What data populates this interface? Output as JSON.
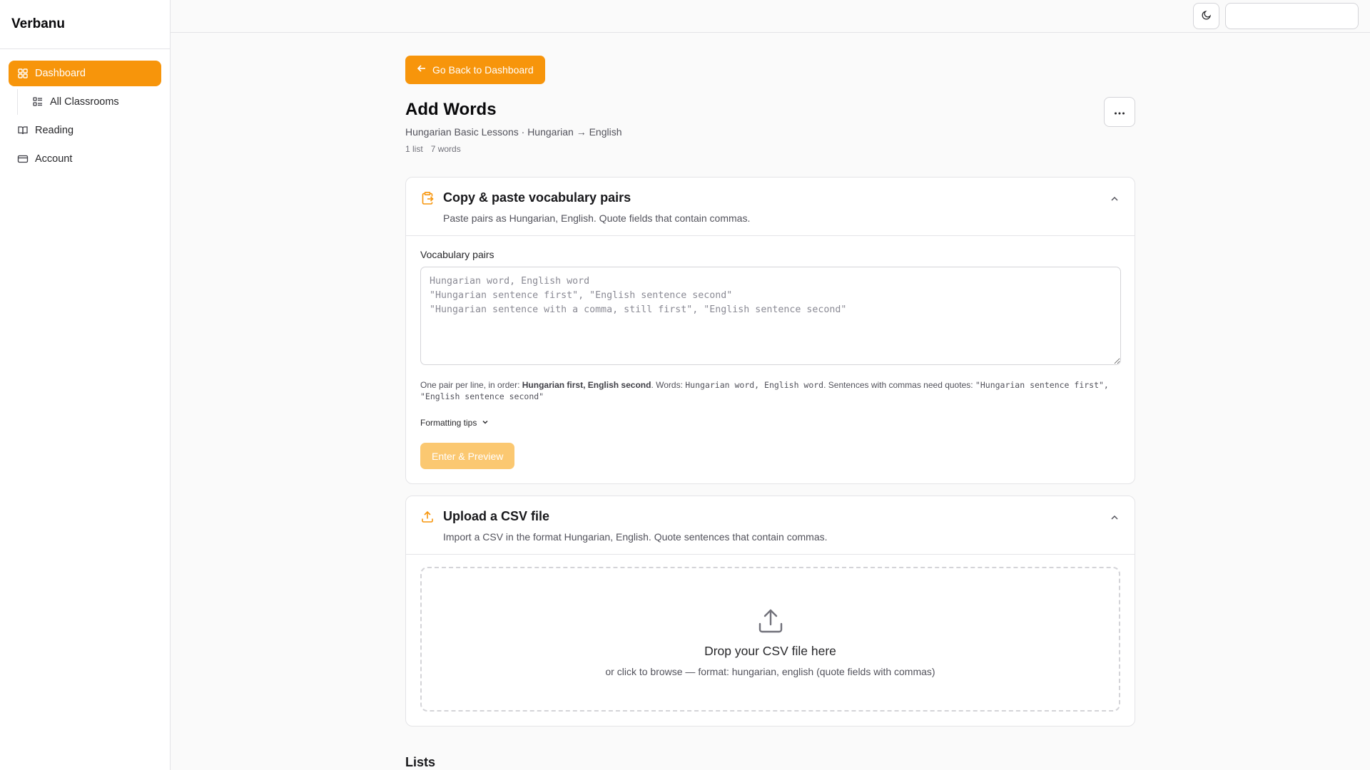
{
  "app": {
    "brand": "Verbanu"
  },
  "sidebar": {
    "items": [
      {
        "label": "Dashboard",
        "icon": "layout-grid-icon",
        "active": true
      },
      {
        "label": "All Classrooms",
        "icon": "list-icon",
        "sub": true
      },
      {
        "label": "Reading",
        "icon": "book-open-icon"
      },
      {
        "label": "Account",
        "icon": "credit-card-icon"
      }
    ]
  },
  "topbar": {
    "theme_icon": "moon-icon"
  },
  "header": {
    "back_label": "Go Back to Dashboard",
    "title": "Add Words",
    "subtitle": "Hungarian Basic Lessons · Hungarian → English",
    "lists_count": "1 list",
    "words_count": "7 words"
  },
  "paste_card": {
    "title": "Copy & paste vocabulary pairs",
    "description": "Paste pairs as Hungarian, English. Quote fields that contain commas.",
    "field_label": "Vocabulary pairs",
    "placeholder": "Hungarian word, English word\n\"Hungarian sentence first\", \"English sentence second\"\n\"Hungarian sentence with a comma, still first\", \"English sentence second\"",
    "help_1": "One pair per line, in order: ",
    "help_bold": "Hungarian first, English second",
    "help_2": ". Words: ",
    "help_code_1": "Hungarian word, English word",
    "help_3": ". Sentences with commas need quotes: ",
    "help_code_2": "\"Hungarian sentence first\", \"English sentence second\"",
    "tips_label": "Formatting tips",
    "submit_label": "Enter & Preview"
  },
  "upload_card": {
    "title": "Upload a CSV file",
    "description": "Import a CSV in the format Hungarian, English. Quote sentences that contain commas.",
    "drop_title": "Drop your CSV file here",
    "drop_sub": "or click to browse — format: hungarian, english (quote fields with commas)"
  },
  "lists_section": {
    "title": "Lists"
  },
  "colors": {
    "accent": "#f7950b",
    "accent_disabled": "#fbc871"
  }
}
